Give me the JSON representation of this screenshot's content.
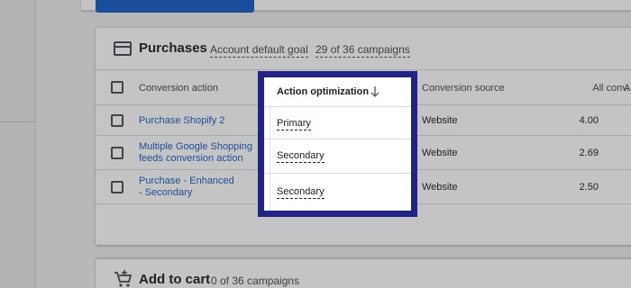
{
  "purchases": {
    "title": "Purchases",
    "goal_link": "Account default goal",
    "campaigns_link": "29 of 36 campaigns"
  },
  "table": {
    "headers": {
      "action": "Conversion action",
      "optimization": "Action optimization",
      "source": "Conversion source",
      "all_conv": "All conv.",
      "next_cut": "A"
    },
    "rows": [
      {
        "action": "Purchase Shopify 2",
        "optimization": "Primary",
        "source": "Website",
        "all_conv": "4.00"
      },
      {
        "action": "Multiple Google Shopping feeds conversion action",
        "optimization": "Secondary",
        "source": "Website",
        "all_conv": "2.69"
      },
      {
        "action": "Purchase - Enhanced - Secondary",
        "optimization": "Secondary",
        "source": "Website",
        "all_conv": "2.50"
      }
    ]
  },
  "add_to_cart": {
    "title": "Add to cart",
    "campaigns": "0 of 36 campaigns"
  },
  "icons": {
    "purchases": "credit-card-icon",
    "sort": "arrow-down-icon",
    "cart": "add-to-cart-icon"
  },
  "colors": {
    "link": "#1a4e9a",
    "highlight_border": "#212387",
    "overlay": "#c4c4c4"
  }
}
